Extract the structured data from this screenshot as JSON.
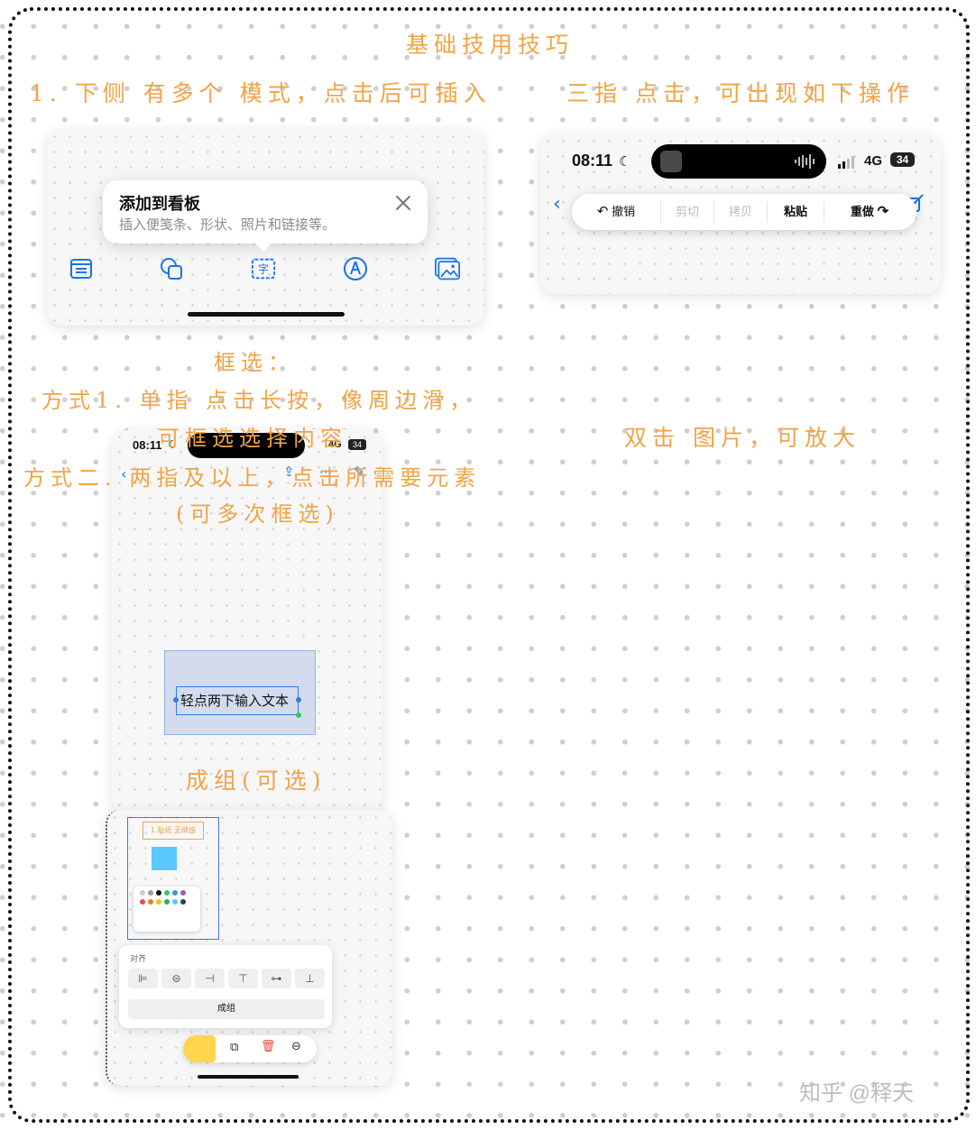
{
  "header_title": "基础技用技巧",
  "notes": {
    "insert_modes": "1. 下侧 有多个 模式，点击后可插入",
    "three_finger": "三指 点击，可出现如下操作",
    "select_title": "框选：",
    "select_way1_line1": "方式1. 单指 点击长按，像周边滑，",
    "select_way1_line2": "可框选选择内容",
    "select_way2_line1": "方式二. 两指及以上，点击所需要元素",
    "select_way2_line2": "(可多次框选)",
    "double_tap": "双击 图片，可放大",
    "group": "成组(可选)"
  },
  "add_to_board": {
    "title": "添加到看板",
    "subtitle": "插入便笺条、形状、照片和链接等。",
    "close_icon": "close-icon",
    "tools": [
      "note-icon",
      "shapes-icon",
      "text-box-icon",
      "pen-icon",
      "photos-icon"
    ]
  },
  "phone_status": {
    "time": "08:11",
    "network": "4G",
    "battery": "34"
  },
  "edit_menu": {
    "undo": "撤销",
    "cut": "剪切",
    "copy": "拷贝",
    "paste": "粘贴",
    "redo": "重做"
  },
  "canvas_text": "轻点两下输入文本",
  "group_panel": {
    "align_label": "对齐",
    "group_button": "成组",
    "mini_note": "1.贴纸 无缝拖"
  },
  "watermark": "知乎 @释天",
  "colors": {
    "handwriting": "#f0a447",
    "accent": "#1a73e8",
    "selection": "#d3dcef"
  }
}
